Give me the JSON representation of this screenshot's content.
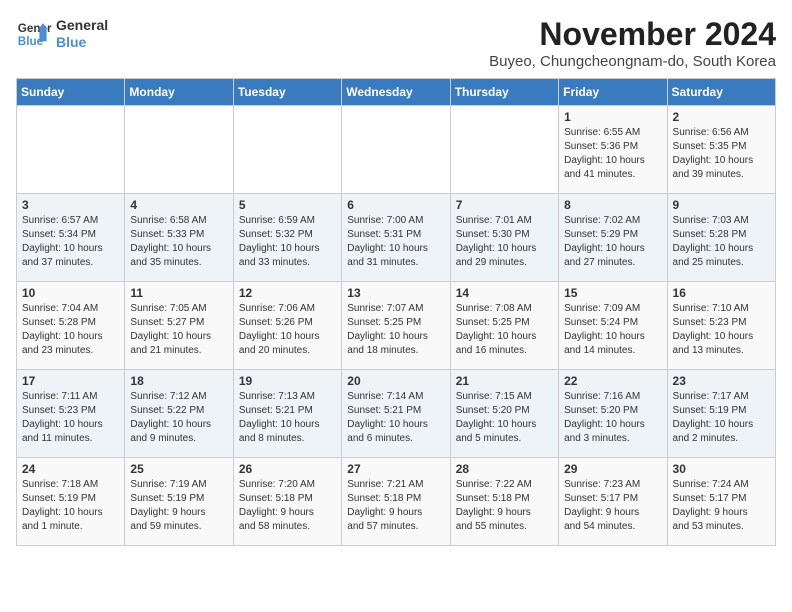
{
  "header": {
    "logo_line1": "General",
    "logo_line2": "Blue",
    "month": "November 2024",
    "location": "Buyeo, Chungcheongnam-do, South Korea"
  },
  "days_of_week": [
    "Sunday",
    "Monday",
    "Tuesday",
    "Wednesday",
    "Thursday",
    "Friday",
    "Saturday"
  ],
  "weeks": [
    [
      {
        "day": "",
        "info": ""
      },
      {
        "day": "",
        "info": ""
      },
      {
        "day": "",
        "info": ""
      },
      {
        "day": "",
        "info": ""
      },
      {
        "day": "",
        "info": ""
      },
      {
        "day": "1",
        "info": "Sunrise: 6:55 AM\nSunset: 5:36 PM\nDaylight: 10 hours\nand 41 minutes."
      },
      {
        "day": "2",
        "info": "Sunrise: 6:56 AM\nSunset: 5:35 PM\nDaylight: 10 hours\nand 39 minutes."
      }
    ],
    [
      {
        "day": "3",
        "info": "Sunrise: 6:57 AM\nSunset: 5:34 PM\nDaylight: 10 hours\nand 37 minutes."
      },
      {
        "day": "4",
        "info": "Sunrise: 6:58 AM\nSunset: 5:33 PM\nDaylight: 10 hours\nand 35 minutes."
      },
      {
        "day": "5",
        "info": "Sunrise: 6:59 AM\nSunset: 5:32 PM\nDaylight: 10 hours\nand 33 minutes."
      },
      {
        "day": "6",
        "info": "Sunrise: 7:00 AM\nSunset: 5:31 PM\nDaylight: 10 hours\nand 31 minutes."
      },
      {
        "day": "7",
        "info": "Sunrise: 7:01 AM\nSunset: 5:30 PM\nDaylight: 10 hours\nand 29 minutes."
      },
      {
        "day": "8",
        "info": "Sunrise: 7:02 AM\nSunset: 5:29 PM\nDaylight: 10 hours\nand 27 minutes."
      },
      {
        "day": "9",
        "info": "Sunrise: 7:03 AM\nSunset: 5:28 PM\nDaylight: 10 hours\nand 25 minutes."
      }
    ],
    [
      {
        "day": "10",
        "info": "Sunrise: 7:04 AM\nSunset: 5:28 PM\nDaylight: 10 hours\nand 23 minutes."
      },
      {
        "day": "11",
        "info": "Sunrise: 7:05 AM\nSunset: 5:27 PM\nDaylight: 10 hours\nand 21 minutes."
      },
      {
        "day": "12",
        "info": "Sunrise: 7:06 AM\nSunset: 5:26 PM\nDaylight: 10 hours\nand 20 minutes."
      },
      {
        "day": "13",
        "info": "Sunrise: 7:07 AM\nSunset: 5:25 PM\nDaylight: 10 hours\nand 18 minutes."
      },
      {
        "day": "14",
        "info": "Sunrise: 7:08 AM\nSunset: 5:25 PM\nDaylight: 10 hours\nand 16 minutes."
      },
      {
        "day": "15",
        "info": "Sunrise: 7:09 AM\nSunset: 5:24 PM\nDaylight: 10 hours\nand 14 minutes."
      },
      {
        "day": "16",
        "info": "Sunrise: 7:10 AM\nSunset: 5:23 PM\nDaylight: 10 hours\nand 13 minutes."
      }
    ],
    [
      {
        "day": "17",
        "info": "Sunrise: 7:11 AM\nSunset: 5:23 PM\nDaylight: 10 hours\nand 11 minutes."
      },
      {
        "day": "18",
        "info": "Sunrise: 7:12 AM\nSunset: 5:22 PM\nDaylight: 10 hours\nand 9 minutes."
      },
      {
        "day": "19",
        "info": "Sunrise: 7:13 AM\nSunset: 5:21 PM\nDaylight: 10 hours\nand 8 minutes."
      },
      {
        "day": "20",
        "info": "Sunrise: 7:14 AM\nSunset: 5:21 PM\nDaylight: 10 hours\nand 6 minutes."
      },
      {
        "day": "21",
        "info": "Sunrise: 7:15 AM\nSunset: 5:20 PM\nDaylight: 10 hours\nand 5 minutes."
      },
      {
        "day": "22",
        "info": "Sunrise: 7:16 AM\nSunset: 5:20 PM\nDaylight: 10 hours\nand 3 minutes."
      },
      {
        "day": "23",
        "info": "Sunrise: 7:17 AM\nSunset: 5:19 PM\nDaylight: 10 hours\nand 2 minutes."
      }
    ],
    [
      {
        "day": "24",
        "info": "Sunrise: 7:18 AM\nSunset: 5:19 PM\nDaylight: 10 hours\nand 1 minute."
      },
      {
        "day": "25",
        "info": "Sunrise: 7:19 AM\nSunset: 5:19 PM\nDaylight: 9 hours\nand 59 minutes."
      },
      {
        "day": "26",
        "info": "Sunrise: 7:20 AM\nSunset: 5:18 PM\nDaylight: 9 hours\nand 58 minutes."
      },
      {
        "day": "27",
        "info": "Sunrise: 7:21 AM\nSunset: 5:18 PM\nDaylight: 9 hours\nand 57 minutes."
      },
      {
        "day": "28",
        "info": "Sunrise: 7:22 AM\nSunset: 5:18 PM\nDaylight: 9 hours\nand 55 minutes."
      },
      {
        "day": "29",
        "info": "Sunrise: 7:23 AM\nSunset: 5:17 PM\nDaylight: 9 hours\nand 54 minutes."
      },
      {
        "day": "30",
        "info": "Sunrise: 7:24 AM\nSunset: 5:17 PM\nDaylight: 9 hours\nand 53 minutes."
      }
    ]
  ]
}
